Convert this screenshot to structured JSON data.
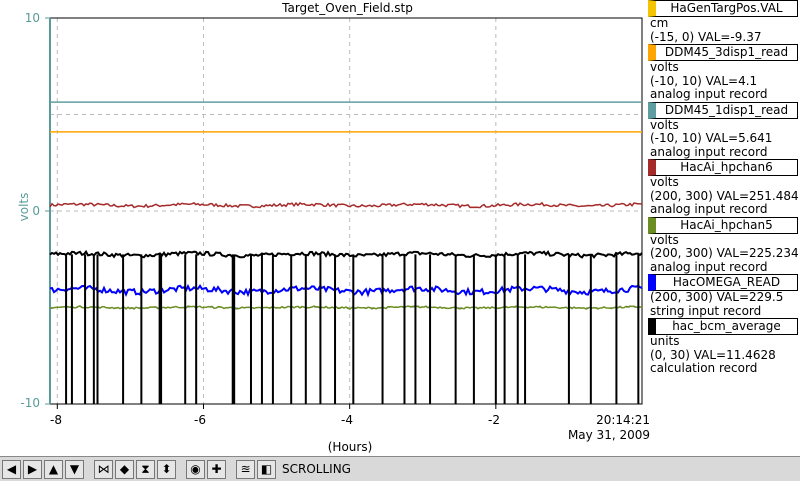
{
  "plot": {
    "title": "Target_Oven_Field.stp",
    "y_axis_label": "volts",
    "x_axis_label": "(Hours)",
    "time_stamp": "20:14:21",
    "date_stamp": "May 31, 2009",
    "y_ticks": [
      "10",
      "0",
      "-10"
    ],
    "x_ticks": [
      "-8",
      "-6",
      "-4",
      "-2"
    ]
  },
  "legend": [
    {
      "name": "HaGenTargPos.VAL",
      "color": "#f5c400",
      "lines": [
        "cm",
        "(-15, 0) VAL=-9.37"
      ]
    },
    {
      "name": "DDM45_3disp1_read",
      "color": "#ffa500",
      "lines": [
        "volts",
        "(-10, 10) VAL=4.1",
        "analog input record"
      ]
    },
    {
      "name": "DDM45_1disp1_read",
      "color": "#5f9ea0",
      "lines": [
        "volts",
        "(-10, 10) VAL=5.641",
        "analog input record"
      ]
    },
    {
      "name": "HacAi_hpchan6",
      "color": "#a52a2a",
      "lines": [
        "volts",
        "(200, 300) VAL=251.484",
        "analog input record"
      ]
    },
    {
      "name": "HacAi_hpchan5",
      "color": "#6b8e23",
      "lines": [
        "volts",
        "(200, 300) VAL=225.234",
        "analog input record"
      ]
    },
    {
      "name": "HacOMEGA_READ",
      "color": "#0000ff",
      "lines": [
        "(200, 300) VAL=229.5",
        "string input record"
      ]
    },
    {
      "name": "hac_bcm_average",
      "color": "#000000",
      "lines": [
        "units",
        "(0, 30) VAL=11.4628",
        "calculation record"
      ]
    }
  ],
  "chart_data": {
    "type": "line",
    "x_range": [
      -8.1,
      0
    ],
    "y_range": [
      -10,
      10
    ],
    "grid": true,
    "series": [
      {
        "name": "DDM45_1disp1_read",
        "color": "#5f9ea0",
        "mean": 5.64,
        "noise": 0.0
      },
      {
        "name": "DDM45_3disp1_read",
        "color": "#ffa500",
        "mean": 4.1,
        "noise": 0.0
      },
      {
        "name": "HacAi_hpchan6",
        "color": "#a52a2a",
        "mean": 0.3,
        "noise": 0.08
      },
      {
        "name": "hac_bcm_average",
        "color": "#000000",
        "mean": -2.25,
        "noise": 0.1
      },
      {
        "name": "HacOMEGA_READ",
        "color": "#0000ff",
        "mean": -4.1,
        "noise": 0.15
      },
      {
        "name": "HacAi_hpchan5",
        "color": "#6b8e23",
        "mean": -5.0,
        "noise": 0.05
      }
    ]
  },
  "toolbar": {
    "status": "SCROLLING",
    "buttons": [
      {
        "name": "scroll-left-icon",
        "glyph": "◀"
      },
      {
        "name": "scroll-right-icon",
        "glyph": "▶"
      },
      {
        "name": "scroll-up-icon",
        "glyph": "▲"
      },
      {
        "name": "scroll-down-icon",
        "glyph": "▼"
      },
      {
        "name": "zoom-in-x-icon",
        "glyph": "⋈"
      },
      {
        "name": "zoom-out-x-icon",
        "glyph": "◆"
      },
      {
        "name": "zoom-in-y-icon",
        "glyph": "⧗"
      },
      {
        "name": "zoom-out-y-icon",
        "glyph": "⬍"
      },
      {
        "name": "auto-scale-icon",
        "glyph": "◉"
      },
      {
        "name": "add-icon",
        "glyph": "✚"
      },
      {
        "name": "stagger-icon",
        "glyph": "≊"
      },
      {
        "name": "pin-icon",
        "glyph": "◧"
      }
    ]
  }
}
